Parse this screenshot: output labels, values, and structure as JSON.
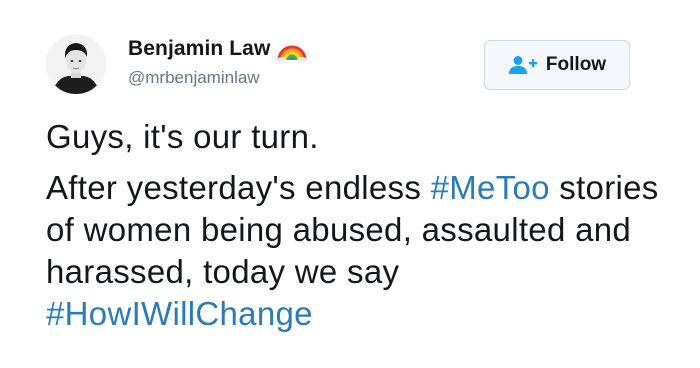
{
  "user": {
    "display_name": "Benjamin Law",
    "handle": "@mrbenjaminlaw",
    "badge_icon": "rainbow-emoji-icon",
    "avatar_icon": "user-avatar"
  },
  "follow_button": {
    "label": "Follow",
    "icon": "add-user-icon",
    "accent": "#1da1f2"
  },
  "tweet": {
    "line1": "Guys, it's our turn.",
    "p1": "After yesterday's endless ",
    "hashtag1": "#MeToo",
    "p2": " stories of women being abused, assaulted and harassed, today we say ",
    "hashtag2": "#HowIWillChange"
  },
  "colors": {
    "text": "#14171a",
    "secondary": "#657786",
    "link": "#2b7bb9"
  }
}
